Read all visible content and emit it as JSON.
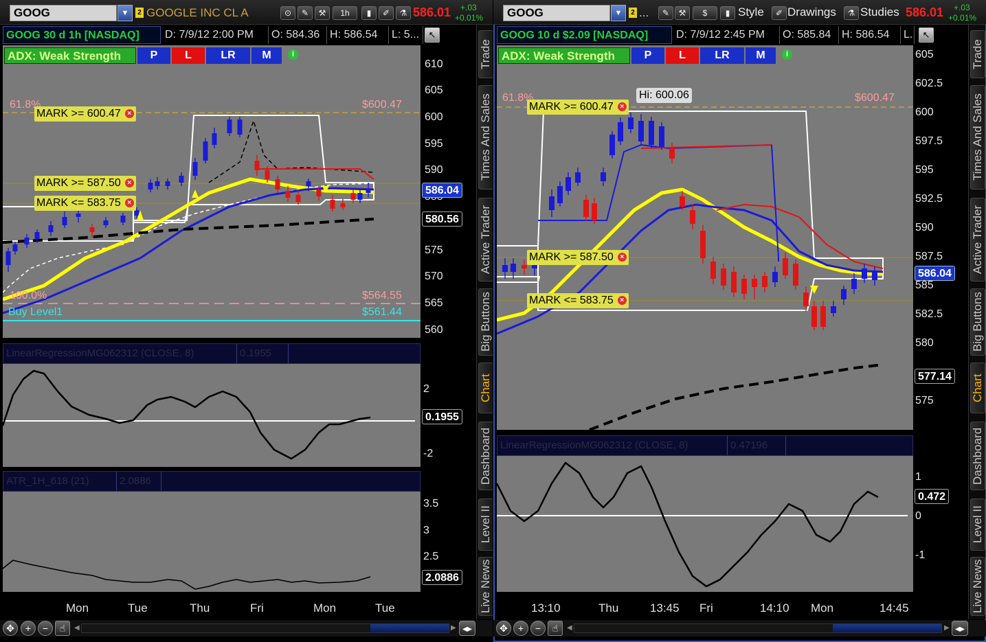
{
  "colors": {
    "up": "#1a1ad8",
    "down": "#e21515",
    "accent": "#2a58c0",
    "alert": "#e0e04a",
    "fib": "#ff9a9a",
    "buy": "#30e8e8",
    "price_up": "#2ecf3a",
    "last": "#ff2020"
  },
  "left": {
    "symbol": "GOOG",
    "link_number": "2",
    "company": "GOOGLE INC CL A",
    "tool_icons": [
      "style-icon",
      "drawing-icon",
      "wrench-icon"
    ],
    "aggregation": "1h",
    "last": "586.01",
    "change": "+.03",
    "change_pct": "+0.01%",
    "header": {
      "title": "GOOG 30 d 1h [NASDAQ]",
      "date": "D: 7/9/12 2:00 PM",
      "open": "O: 584.36",
      "high": "H: 586.54",
      "low": "L: 5..."
    },
    "adx": {
      "label": "ADX:  Weak Strength",
      "buttons": [
        "P",
        "L",
        "LR",
        "M"
      ]
    },
    "price_axis": [
      "610",
      "605",
      "600",
      "595",
      "590",
      "585",
      "580",
      "575",
      "570",
      "565",
      "560"
    ],
    "price_tag": "586.04",
    "price_tag2": "580.56",
    "fib_top_label": "61.8%",
    "fib_top_value": "$600.47",
    "fib_bottom_label": "100.0%",
    "fib_bottom_value": "$564.55",
    "buy_label": "Buy Level1",
    "buy_value": "$561.44",
    "alerts": [
      "MARK >= 600.47",
      "MARK >= 587.50",
      "MARK <= 583.75"
    ],
    "study1": {
      "name": "LinearRegressionMG062312 (CLOSE, 8)",
      "value": "0.1955",
      "axis": [
        "2",
        "-2"
      ],
      "tag": "0.1955"
    },
    "study2": {
      "name": "ATR_1H_618 (21)",
      "value": "2.0886",
      "axis": [
        "3.5",
        "3",
        "2.5"
      ],
      "tag": "2.0886"
    },
    "x_labels": [
      "Mon",
      "Tue",
      "Thu",
      "Fri",
      "Mon",
      "Tue"
    ],
    "sidebar_tabs": [
      "Trade",
      "Times And Sales",
      "Active Trader",
      "Big Buttons",
      "Chart",
      "Dashboard",
      "Level II",
      "Live News"
    ],
    "active_tab": "Chart"
  },
  "right": {
    "symbol": "GOOG",
    "link_number": "2",
    "link_more": "...",
    "tool_icons": [
      "drawing-icon",
      "wrench-icon"
    ],
    "currency_button": "$",
    "style_label": "Style",
    "drawings_label": "Drawings",
    "studies_label": "Studies",
    "last": "586.01",
    "change": "+.03",
    "change_pct": "+0.01%",
    "header": {
      "title": "GOOG 10 d $2.09 [NASDAQ]",
      "date": "D: 7/9/12 2:45 PM",
      "open": "O: 585.84",
      "high": "H: 586.54",
      "low": "L..."
    },
    "adx": {
      "label": "ADX:  Weak Strength",
      "buttons": [
        "P",
        "L",
        "LR",
        "M"
      ]
    },
    "price_axis": [
      "605",
      "602.5",
      "600",
      "597.5",
      "595",
      "592.5",
      "590",
      "587.5",
      "585",
      "582.5",
      "580",
      "575"
    ],
    "price_tag": "586.04",
    "price_tag2": "577.14",
    "hi_label": "Hi: 600.06",
    "fib_top_label": "61.8%",
    "fib_top_value": "$600.47",
    "alerts": [
      "MARK >= 600.47",
      "MARK >= 587.50",
      "MARK <= 583.75"
    ],
    "study1": {
      "name": "LinearRegressionMG062312 (CLOSE, 8)",
      "value": "0.47196",
      "axis": [
        "1",
        "0",
        "-1"
      ],
      "tag": "0.472"
    },
    "x_labels": [
      "13:10",
      "Thu",
      "13:45",
      "Fri",
      "14:10",
      "Mon",
      "14:45"
    ],
    "sidebar_tabs": [
      "Trade",
      "Times And Sales",
      "Active Trader",
      "Big Buttons",
      "Chart",
      "Dashboard",
      "Level II",
      "Live News"
    ],
    "active_tab": "Chart"
  }
}
